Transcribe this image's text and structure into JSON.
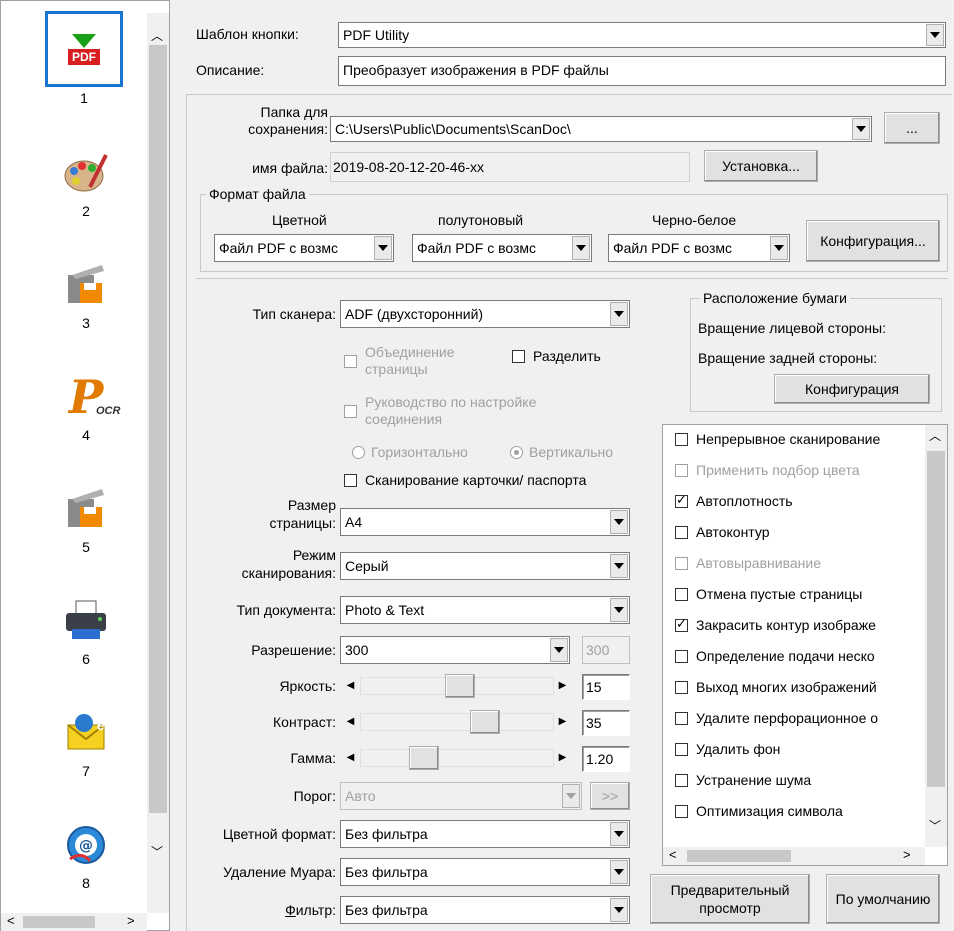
{
  "left_panel": {
    "items": [
      {
        "num": "1",
        "icon": "pdf-utility-icon"
      },
      {
        "num": "2",
        "icon": "paint-palette-icon"
      },
      {
        "num": "3",
        "icon": "scanner-save-icon"
      },
      {
        "num": "4",
        "icon": "ocr-icon"
      },
      {
        "num": "5",
        "icon": "scanner-save-icon"
      },
      {
        "num": "6",
        "icon": "printer-icon"
      },
      {
        "num": "7",
        "icon": "email-icon"
      },
      {
        "num": "8",
        "icon": "web-icon"
      }
    ],
    "pdf_badge": "PDF",
    "ocr_letter": "P",
    "ocr_badge": "OCR",
    "email_letter": "e"
  },
  "header": {
    "template_label": "Шаблон кнопки:",
    "template_value": "PDF Utility",
    "desc_label": "Описание:",
    "desc_value": "Преобразует изображения в PDF файлы"
  },
  "save": {
    "folder_label_1": "Папка для",
    "folder_label_2": "сохранения:",
    "folder_value": "C:\\Users\\Public\\Documents\\ScanDoc\\",
    "browse_label": "...",
    "filename_label": "имя файла:",
    "filename_value": "2019-08-20-12-20-46-xx",
    "setup_label": "Установка..."
  },
  "file_format": {
    "group_label": "Формат файла",
    "color_label": "Цветной",
    "gray_label": "полутоновый",
    "bw_label": "Черно-белое",
    "color_value": "Файл PDF с возмс",
    "gray_value": "Файл PDF с возмс",
    "bw_value": "Файл PDF с возмс",
    "config_label": "Конфигурация..."
  },
  "scanner": {
    "type_label": "Тип сканера:",
    "type_value": "ADF (двухсторонний)",
    "merge_label_1": "Объединение",
    "merge_label_2": "страницы",
    "split_label": "Разделить",
    "join_guide_1": "Руководство по настройке",
    "join_guide_2": "соединения",
    "horizontal_label": "Горизонтально",
    "vertical_label": "Вертикально",
    "card_label": "Сканирование карточки/ паспорта",
    "page_size_label_1": "Размер",
    "page_size_label_2": "страницы:",
    "page_size_value": "A4",
    "scan_mode_label_1": "Режим",
    "scan_mode_label_2": "сканирования:",
    "scan_mode_value": "Серый",
    "doc_type_label": "Тип документа:",
    "doc_type_value": "Photo & Text",
    "resolution_label": "Разрешение:",
    "resolution_value": "300",
    "resolution_box": "300",
    "brightness_label": "Яркость:",
    "brightness_value": "15",
    "brightness_level": 0.52,
    "contrast_label": "Контраст:",
    "contrast_value": "35",
    "contrast_level": 0.67,
    "gamma_label": "Гамма:",
    "gamma_value": "1.20",
    "gamma_level": 0.3,
    "threshold_label": "Порог:",
    "threshold_value": "Авто",
    "threshold_btn": ">>",
    "color_format_label": "Цветной формат:",
    "color_format_value": "Без фильтра",
    "moire_label": "Удаление Муара:",
    "moire_value": "Без фильтра",
    "filter_label_underlined": "Ф",
    "filter_label_rest": "ильтр:",
    "filter_value": "Без фильтра"
  },
  "paper": {
    "group_label": "Расположение бумаги",
    "front_label": "Вращение лицевой стороны:",
    "back_label": "Вращение задней стороны:",
    "config_label": "Конфигурация"
  },
  "options": [
    {
      "label": "Непрерывное сканирование",
      "checked": false,
      "disabled": false
    },
    {
      "label": "Применить подбор цвета",
      "checked": false,
      "disabled": true
    },
    {
      "label": "Автоплотность",
      "checked": true,
      "disabled": false
    },
    {
      "label": "Автоконтур",
      "checked": false,
      "disabled": false
    },
    {
      "label": "Автовыравнивание",
      "checked": false,
      "disabled": true
    },
    {
      "label": "Отмена пустые страницы",
      "checked": false,
      "disabled": false
    },
    {
      "label": "Закрасить контур изображе",
      "checked": true,
      "disabled": false
    },
    {
      "label": "Определение подачи неско",
      "checked": false,
      "disabled": false
    },
    {
      "label": "Выход многих изображений",
      "checked": false,
      "disabled": false
    },
    {
      "label": "Удалите перфорационное о",
      "checked": false,
      "disabled": false
    },
    {
      "label": "Удалить фон",
      "checked": false,
      "disabled": false
    },
    {
      "label": "Устранение шума",
      "checked": false,
      "disabled": false
    },
    {
      "label": "Оптимизация символа",
      "checked": false,
      "disabled": false
    }
  ],
  "bottom": {
    "preview_label_1": "Предварительный",
    "preview_label_2": "просмотр",
    "default_label": "По умолчанию"
  }
}
